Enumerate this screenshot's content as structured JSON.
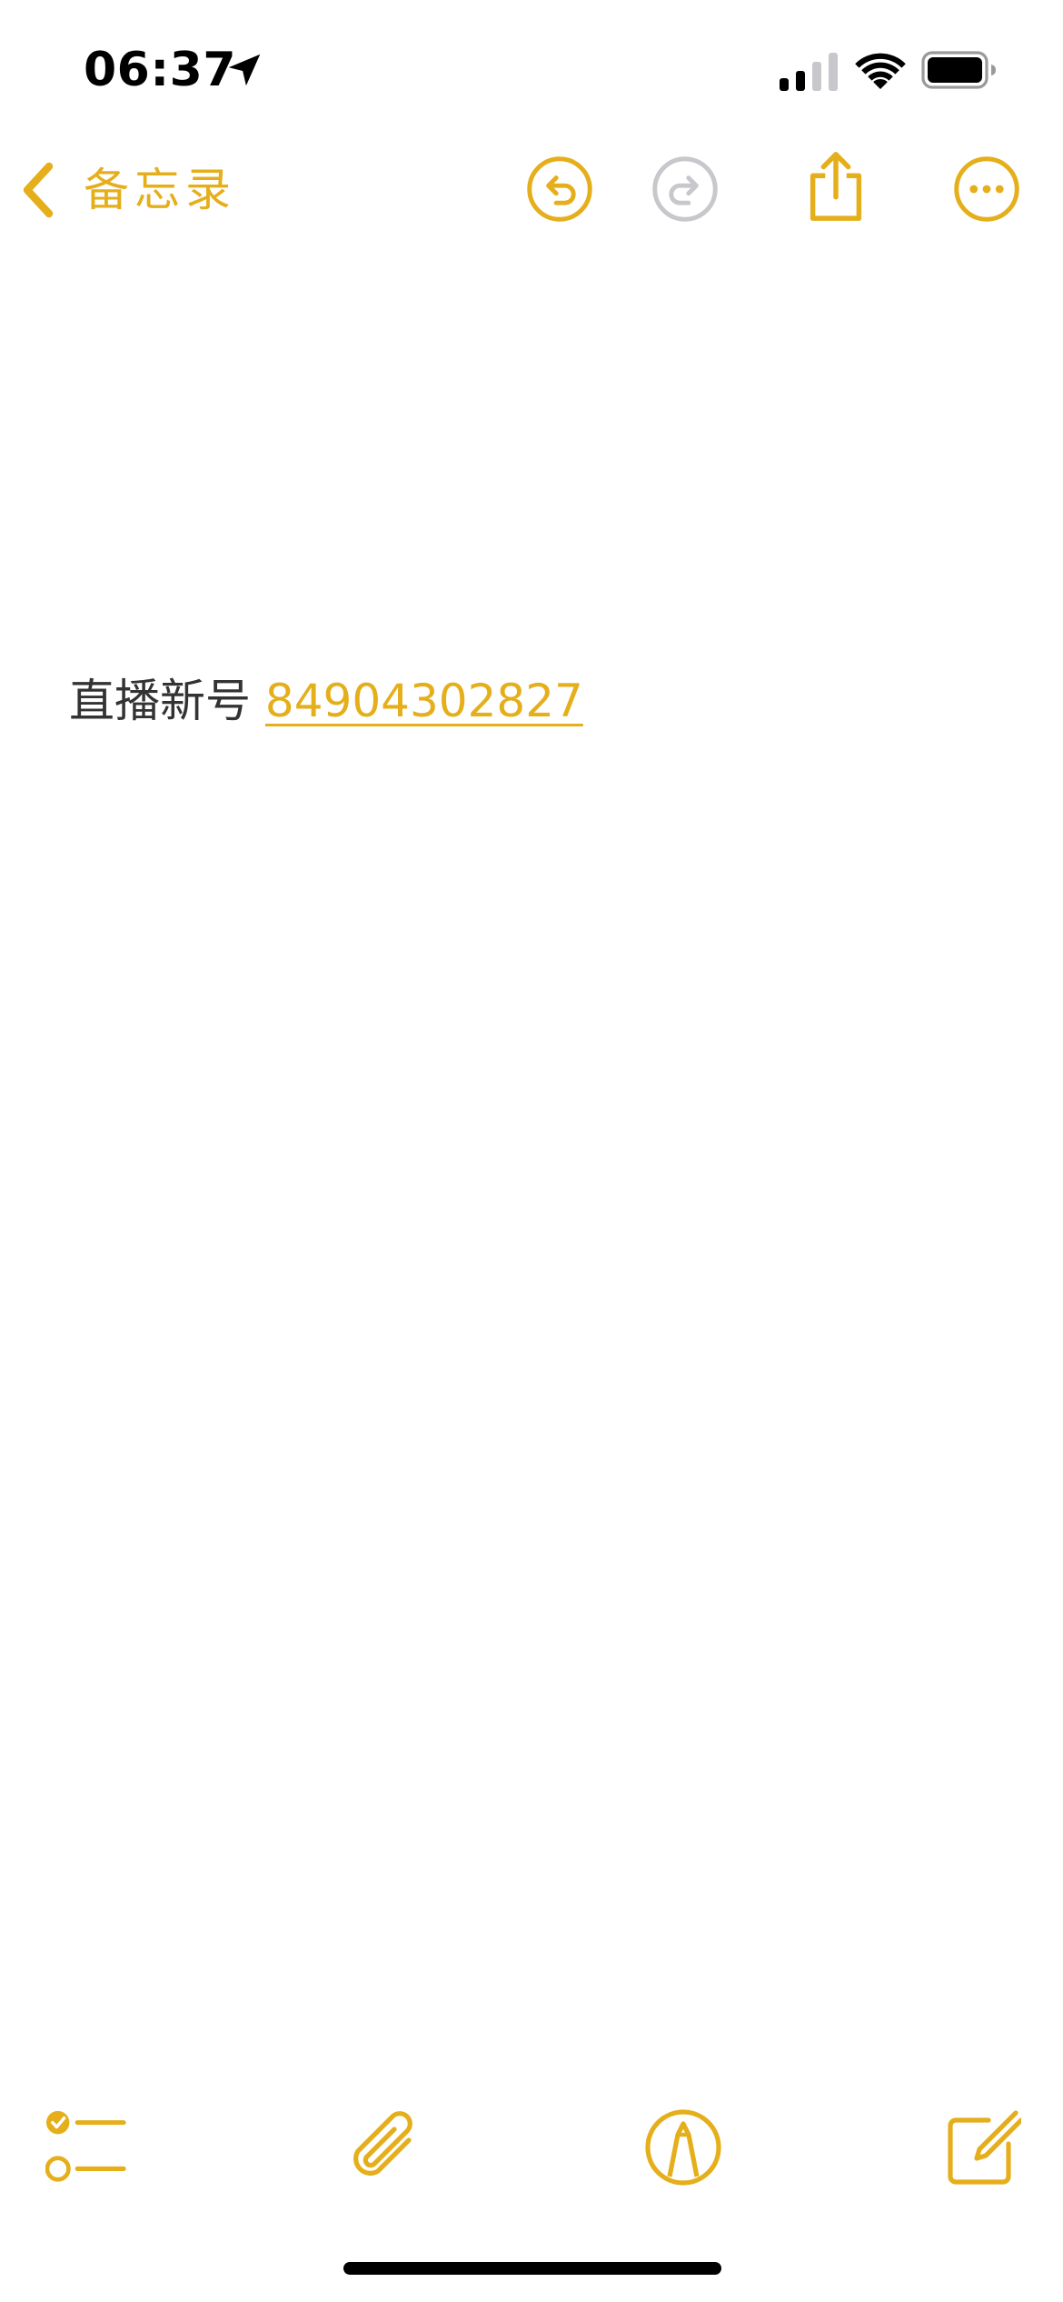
{
  "status_bar": {
    "time": "06:37",
    "icons": [
      "location-arrow-icon",
      "cellular-signal-icon",
      "wifi-icon",
      "battery-icon"
    ]
  },
  "nav": {
    "back_label": "备忘录",
    "icons": [
      "chevron-left-icon",
      "undo-icon",
      "redo-icon",
      "share-icon",
      "more-icon"
    ]
  },
  "note": {
    "text": "直播新号",
    "link": "84904302827"
  },
  "toolbar": {
    "icons": [
      "checklist-icon",
      "paperclip-icon",
      "markup-pen-icon",
      "compose-icon"
    ]
  },
  "colors": {
    "accent": "#E5AE1B",
    "disabled": "#C7C7CC",
    "text": "#333333"
  }
}
